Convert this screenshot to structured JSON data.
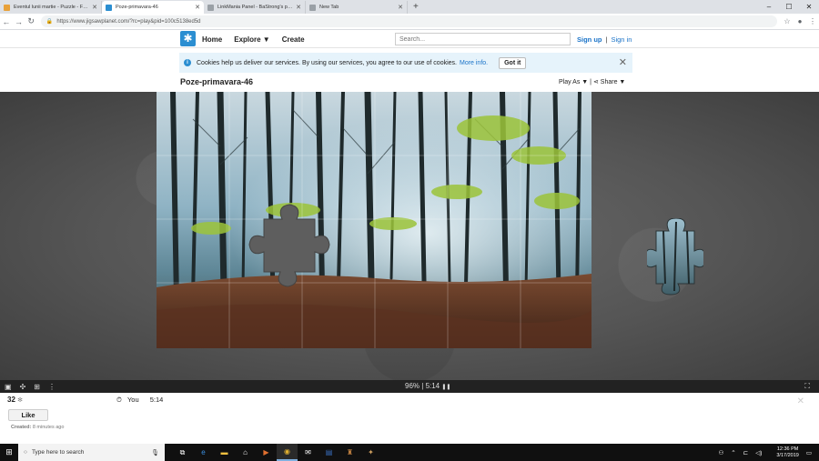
{
  "browser": {
    "tabs": [
      {
        "label": "Eventul lunii martie - Puzzle - Fo...",
        "favicon_color": "#e8a13a",
        "active": false
      },
      {
        "label": "Poze-primavara-46",
        "favicon_color": "#2b8ed1",
        "active": true
      },
      {
        "label": "LinkMania Panel - BaStrong's pro...",
        "favicon_color": "#9aa0a6",
        "active": false
      },
      {
        "label": "New Tab",
        "favicon_color": "#9aa0a6",
        "active": false
      }
    ],
    "new_tab_symbol": "+",
    "url": "https://www.jigsawplanet.com/?rc=play&pid=100c5138ed5d",
    "window_controls": [
      "–",
      "☐",
      "✕"
    ]
  },
  "site": {
    "nav": {
      "home": "Home",
      "explore": "Explore ▼",
      "create": "Create"
    },
    "search_placeholder": "Search...",
    "sign_up": "Sign up",
    "sign_in": "Sign in",
    "separator": "|"
  },
  "cookie": {
    "text": "Cookies help us deliver our services. By using our services, you agree to our use of cookies.",
    "more_info": "More info.",
    "got_it": "Got it"
  },
  "puzzle": {
    "title": "Poze-primavara-46",
    "play_as": "Play As ▼",
    "separator": "|",
    "share": "Share ▼",
    "progress": "96%",
    "time_display": "5:14",
    "pause_symbol": "❚❚",
    "complete_fraction": 0.96
  },
  "stats": {
    "count": "32",
    "player": "You",
    "time": "5:14",
    "like": "Like",
    "created_label": "Created:",
    "created_value": "8 minutes ago"
  },
  "taskbar": {
    "search_placeholder": "Type here to search",
    "time": "12:36 PM",
    "date": "3/17/2019"
  },
  "colors": {
    "accent": "#2b8ed1",
    "link": "#1a73c8",
    "taskbar": "#101010"
  }
}
